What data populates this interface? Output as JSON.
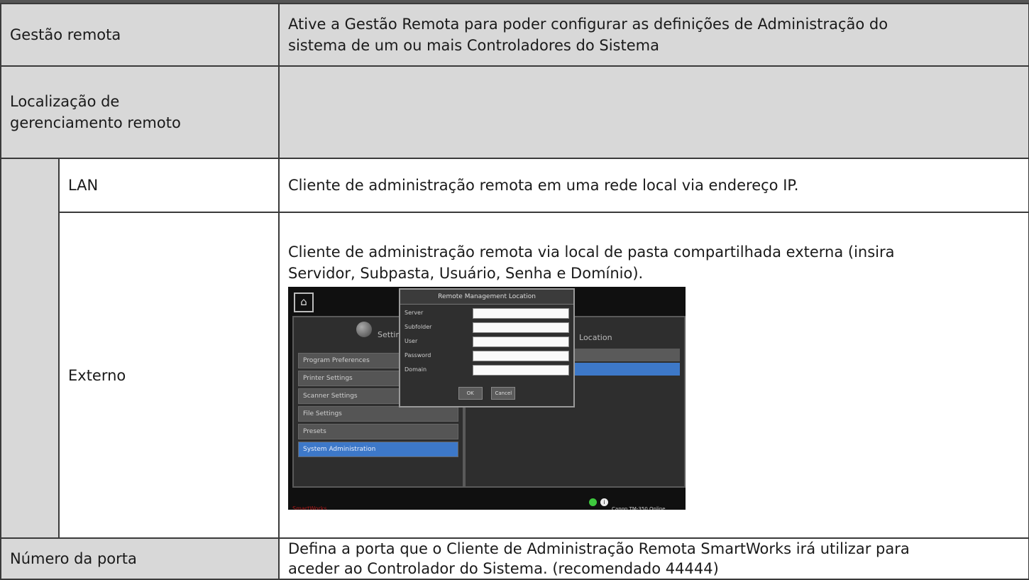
{
  "rows": [
    {
      "label": "Gestão remota",
      "desc_lines": [
        "Ative a Gestão Remota para poder configurar as definições de Administração do",
        "sistema de um ou mais Controladores do Sistema"
      ]
    },
    {
      "label_lines": [
        "Localização de",
        "gerenciamento remoto"
      ],
      "desc": ""
    },
    {
      "label": "LAN",
      "desc": "Cliente de administração remota em uma rede local via endereço IP."
    },
    {
      "label": "Externo",
      "desc_lines": [
        "Cliente de administração remota via local de pasta compartilhada externa (insira",
        "Servidor, Subpasta, Usuário, Senha e Domínio)."
      ]
    },
    {
      "label": "Número da porta",
      "desc_lines": [
        "Defina a porta que o Cliente de Administração Remota SmartWorks irá utilizar para",
        "aceder ao Controlador do Sistema. (recomendado 44444)"
      ]
    }
  ],
  "screenshot": {
    "home_icon": "home-icon",
    "left_panel_title": "Settings",
    "right_panel_title": "Location",
    "menu_items": [
      "Program Preferences",
      "Printer Settings",
      "Scanner Settings",
      "File Settings",
      "Presets",
      "System Administration"
    ],
    "selected_menu_item": "System Administration",
    "dialog": {
      "title": "Remote Management Location",
      "fields": [
        "Server",
        "Subfolder",
        "User",
        "Password",
        "Domain"
      ],
      "ok_label": "OK",
      "cancel_label": "Cancel"
    },
    "status": {
      "brand": "SmartWorks",
      "device": "Canon TM-350 Online"
    },
    "colors": {
      "selection": "#3d78c8",
      "status_ok": "#3ec93e",
      "brand": "#b01818"
    }
  }
}
